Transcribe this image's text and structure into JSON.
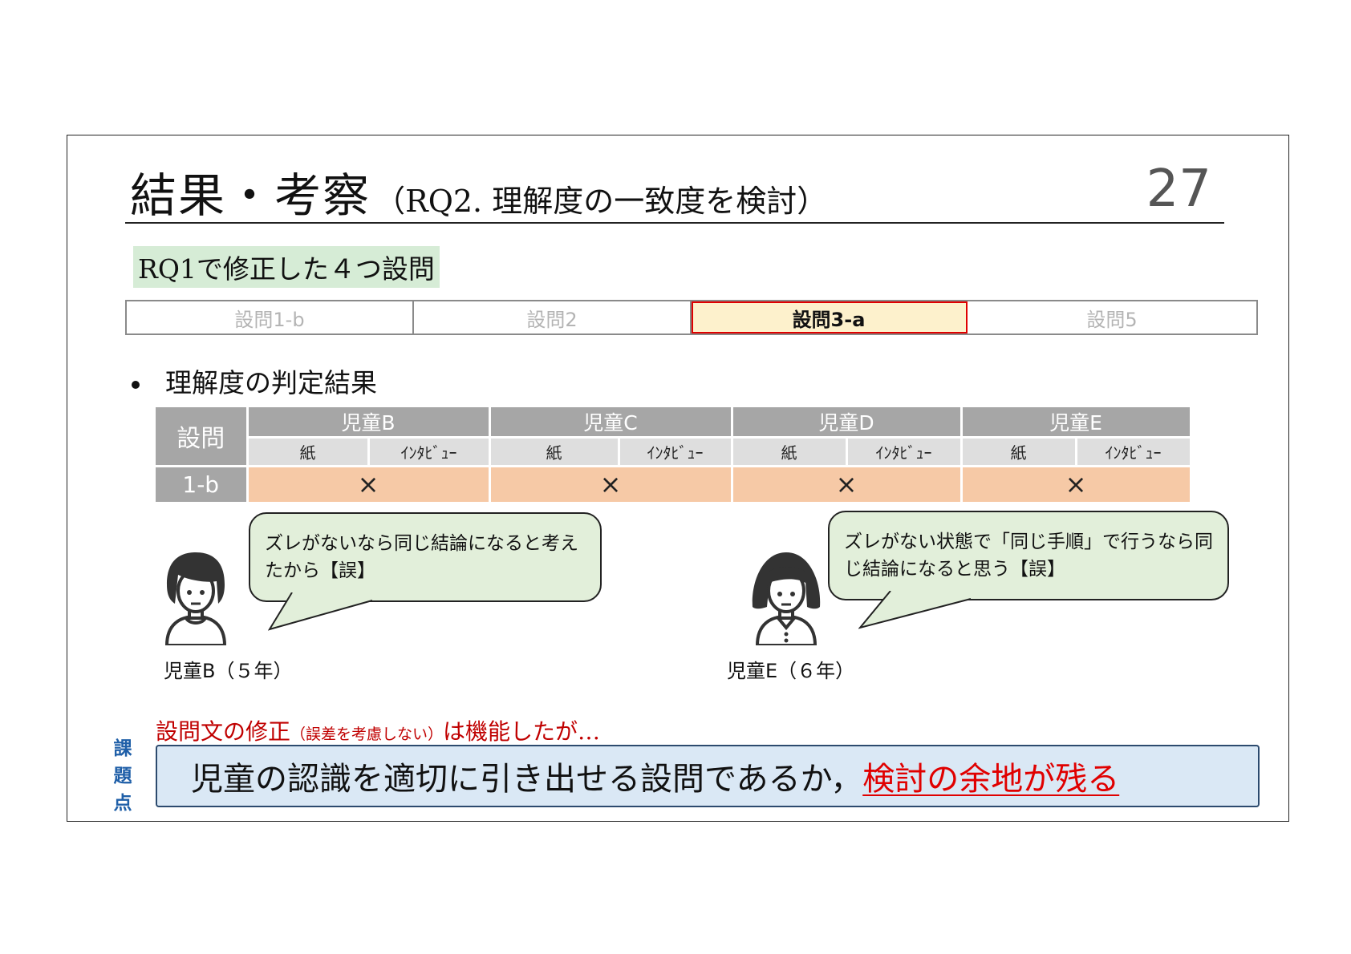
{
  "slide": {
    "title_main": "結果・考察",
    "title_sub": "（RQ2. 理解度の一致度を検討）",
    "page_number": "27",
    "subheading": "RQ1で修正した４つ設問"
  },
  "tabs": [
    {
      "label": "設問1-b",
      "active": false
    },
    {
      "label": "設問2",
      "active": false
    },
    {
      "label": "設問3-a",
      "active": true
    },
    {
      "label": "設問5",
      "active": false
    }
  ],
  "bullet": "理解度の判定結果",
  "table": {
    "question_header": "設問",
    "children": [
      "児童B",
      "児童C",
      "児童D",
      "児童E"
    ],
    "sub_headers": [
      "紙",
      "ｲﾝﾀﾋﾞｭｰ"
    ],
    "row_label": "1-b",
    "row_marks": [
      "×",
      "×",
      "×",
      "×"
    ]
  },
  "students": [
    {
      "caption": "児童B（５年）",
      "comment": "ズレがないなら同じ結論になると考えたから【誤】"
    },
    {
      "caption": "児童E（６年）",
      "comment": "ズレがない状態で「同じ手順」で行うなら同じ結論になると思う【誤】"
    }
  ],
  "issue": {
    "text_a": "設問文の修正",
    "text_small": "（誤差を考慮しない）",
    "text_b": "は機能したが…",
    "side_label": "課題点",
    "conclusion_a": "児童の認識を適切に引き出せる設問であるか，",
    "conclusion_highlight": "検討の余地が残る"
  },
  "colors": {
    "active_tab_fill": "#fdf1cc",
    "active_tab_border": "#e00000",
    "subheading_fill": "#d6ecd6",
    "table_header": "#a6a6a6",
    "table_cell": "#f6c9a6",
    "bubble_fill": "#e2efda",
    "issue_text": "#c00000",
    "conclusion_fill": "#dae8f5",
    "side_label": "#1f5fa8"
  }
}
